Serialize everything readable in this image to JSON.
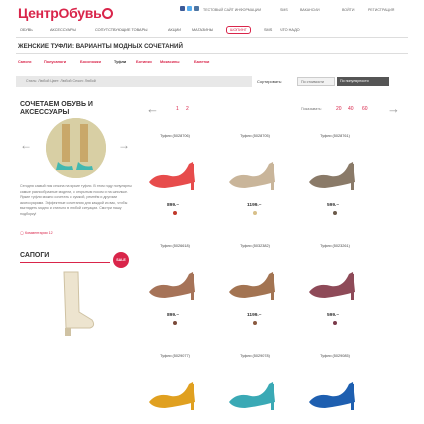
{
  "header": {
    "logo_text": "ЦентрОбувь",
    "links": [
      "Тестовый сайт информации",
      "SMS",
      "Вакансии",
      "Войти",
      "Регистрация"
    ]
  },
  "nav": {
    "items": [
      "Обувь",
      "Аксессуары",
      "Сопутствующие товары",
      "Акции",
      "Магазины",
      "Шопинг",
      "SMS",
      "Что надо"
    ],
    "active_label": "Шопинг"
  },
  "page": {
    "title": "Женские туфли: варианты модных сочетаний",
    "categories": [
      "Сапоги",
      "Полусапоги",
      "Босоножки",
      "Туфли",
      "Ботинки",
      "Мокасины",
      "Балетки"
    ]
  },
  "filter": {
    "text": "Стиль: Любой    Цвет: Любой    Сезон: Любой",
    "sort_label": "Сортировать:",
    "sort_options": [
      "По стоимости",
      "По популярности"
    ]
  },
  "sidebar": {
    "title": "Сочетаем обувь и аксессуары",
    "text": "Сегодня самый пик сезона на яркие туфли. В этом году популярны самые разнообразные модели, с открытым носом и на шпильке. Яркие туфли можно сочетать с сумкой, ремнём и другими аксессуарами. Эффектные сочетания для каждой из вас, чтобы выглядеть модно и стильно в любой ситуации. Смотри нашу подборку!",
    "comment_link": "Комментарии 12",
    "boots_title": "Сапоги",
    "sale_badge": "SALE"
  },
  "pager": {
    "pages": [
      "1",
      "2"
    ],
    "per_page_label": "Показывать:",
    "per_page_options": [
      "20",
      "40",
      "60"
    ]
  },
  "products": [
    {
      "name": "Туфли (5028706)",
      "price": "899.–",
      "swatch": "#c0392b",
      "color": "#e74c4c"
    },
    {
      "name": "Туфли (5028705)",
      "price": "1199.–",
      "swatch": "#d8c08a",
      "color": "#c9b59a"
    },
    {
      "name": "Туфли (5028761)",
      "price": "599.–",
      "swatch": "#6b5a4a",
      "color": "#8a7a68"
    },
    {
      "name": "Туфли (5026618)",
      "price": "899.–",
      "swatch": "#7a4a3a",
      "color": "#a67358"
    },
    {
      "name": "Туфли (5032382)",
      "price": "1199.–",
      "swatch": "#8a5a40",
      "color": "#a37452"
    },
    {
      "name": "Туфли (5023261)",
      "price": "599.–",
      "swatch": "#7a3a4a",
      "color": "#8e4a58"
    },
    {
      "name": "Туфли (5029077)",
      "price": "",
      "swatch": "",
      "color": "#e0a020"
    },
    {
      "name": "Туфли (5029078)",
      "price": "",
      "swatch": "",
      "color": "#3aa9b5"
    },
    {
      "name": "Туфли (5029085)",
      "price": "",
      "swatch": "",
      "color": "#1e5fb0"
    }
  ],
  "colors": {
    "brand": "#d9254a",
    "accent": "#d9254a"
  }
}
